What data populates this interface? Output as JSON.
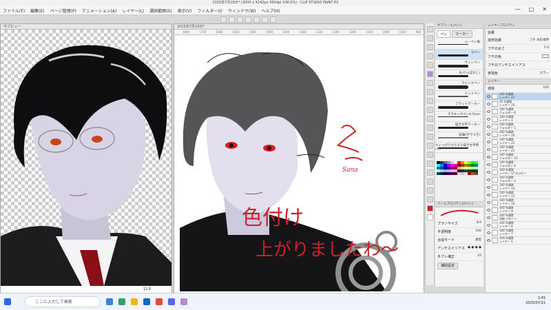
{
  "window": {
    "title": "2025年7月18日* (3000 x 4242px 350dpi 108.0%) - CLIP STUDIO PAINT EX"
  },
  "menu": [
    "ファイル(F)",
    "編集(E)",
    "ページ管理(P)",
    "アニメーション(A)",
    "レイヤー(L)",
    "選択範囲(S)",
    "表示(V)",
    "フィルター(I)",
    "ウィンドウ(W)",
    "ヘルプ(H)"
  ],
  "window_controls": {
    "minimize": "—",
    "maximize": "□",
    "close": "✕"
  },
  "docs": {
    "left_tab": "サブビュー",
    "left_zoom": "12.0",
    "main_tab": "2025年7月18日*",
    "ruler_marks": [
      "1800",
      "1740",
      "1680",
      "1620",
      "1560",
      "1500",
      "1440",
      "1380",
      "1320",
      "1260",
      "1200",
      "1140",
      "1080",
      "1020",
      "960"
    ]
  },
  "handwriting": {
    "sign": "Sana",
    "message_line1": "色付け",
    "message_line2": "上がりましたわ〜"
  },
  "subtool": {
    "header": "サブツール[ペン]",
    "tabs": [
      "ペン",
      "マーカー"
    ],
    "brushes": [
      {
        "name": "ジーペン風",
        "selected": false
      },
      {
        "name": "Gペン",
        "selected": true
      },
      {
        "name": "サインペン",
        "selected": false
      },
      {
        "name": "丸ペン(ぼかし)",
        "selected": false
      },
      {
        "name": "マジックペン",
        "selected": false
      },
      {
        "name": "ドットペン",
        "selected": false
      },
      {
        "name": "フラットマーカー",
        "selected": false
      },
      {
        "name": "マスキングペン0.5mm",
        "selected": false
      },
      {
        "name": "描き文字マーカー",
        "selected": false
      },
      {
        "name": "鉛筆(ザラつき)",
        "selected": false
      },
      {
        "name": "ちょっぴりざらざら描き文字用ペン",
        "selected": false
      }
    ]
  },
  "tool_property": {
    "header": "ツールプロパティ[Gペン]",
    "brush_size_label": "ブラシサイズ",
    "brush_size": "8.0",
    "opacity_label": "不透明度",
    "opacity": "100",
    "blend_label": "合成モード",
    "blend": "通常",
    "aa_label": "アンチエイリアス",
    "stabilize_label": "手ブレ補正",
    "stabilize": "10",
    "detail_button": "補助設定"
  },
  "effects": {
    "header": "レイヤープロパティ",
    "title": "効果",
    "border_effect": "境界効果",
    "border_opt1": "フチ",
    "border_opt2": "水彩境界",
    "edge_width_label": "フチの太さ",
    "edge_width": "5.0",
    "edge_color_label": "フチの色",
    "aa_check": "フチのアンチエイリアス",
    "expression_label": "表現色",
    "expression": "カラー"
  },
  "layers": {
    "header": "レイヤー",
    "blend": "通常",
    "opacity": "100",
    "items": [
      {
        "pct": "100 %通常",
        "name": "レイヤー 27",
        "selected": true
      },
      {
        "pct": "25 %通常",
        "name": "レイヤー 25",
        "selected": false
      },
      {
        "pct": "100 %通常",
        "name": "フォルダー 6",
        "selected": false
      },
      {
        "pct": "100 %通常",
        "name": "レイヤー 1",
        "selected": false
      },
      {
        "pct": "100 %通常",
        "name": "フォルダー 5",
        "selected": false
      },
      {
        "pct": "100 %通常",
        "name": "レイヤー 20",
        "selected": false
      },
      {
        "pct": "100 %通常",
        "name": "レイヤー 22",
        "selected": false
      },
      {
        "pct": "100 %通常",
        "name": "レイヤー 21",
        "selected": false
      },
      {
        "pct": "100 %通常",
        "name": "フォルダー 13",
        "selected": false
      },
      {
        "pct": "100 %通常",
        "name": "フォルダー 4",
        "selected": false
      },
      {
        "pct": "100 %通常",
        "name": "レイヤー 17 のコピー",
        "selected": false
      },
      {
        "pct": "100 %通常",
        "name": "フォルダー 2",
        "selected": false
      },
      {
        "pct": "100 %通常",
        "name": "レイヤー 13",
        "selected": false
      },
      {
        "pct": "100 %通常",
        "name": "レイヤー 11",
        "selected": false
      },
      {
        "pct": "100 %通常",
        "name": "レイヤー 10",
        "selected": false
      },
      {
        "pct": "100 %通常",
        "name": "レイヤー 9",
        "selected": false
      },
      {
        "pct": "100 %通常",
        "name": "用紙 パターン",
        "selected": false
      },
      {
        "pct": "100 %通常",
        "name": "レイヤー 6",
        "selected": false
      },
      {
        "pct": "100 %通常",
        "name": "レイヤー 7",
        "selected": false
      },
      {
        "pct": "100 %通常",
        "name": "レイヤー 5",
        "selected": false
      }
    ]
  },
  "taskbar": {
    "search_placeholder": "ここに入力して検索",
    "time": "1:45",
    "date": "2025/07/21"
  },
  "colors": {
    "accent_purple": "#b38cd6",
    "selection_blue": "#bcd6f2",
    "handwriting_red": "#c8232a"
  }
}
